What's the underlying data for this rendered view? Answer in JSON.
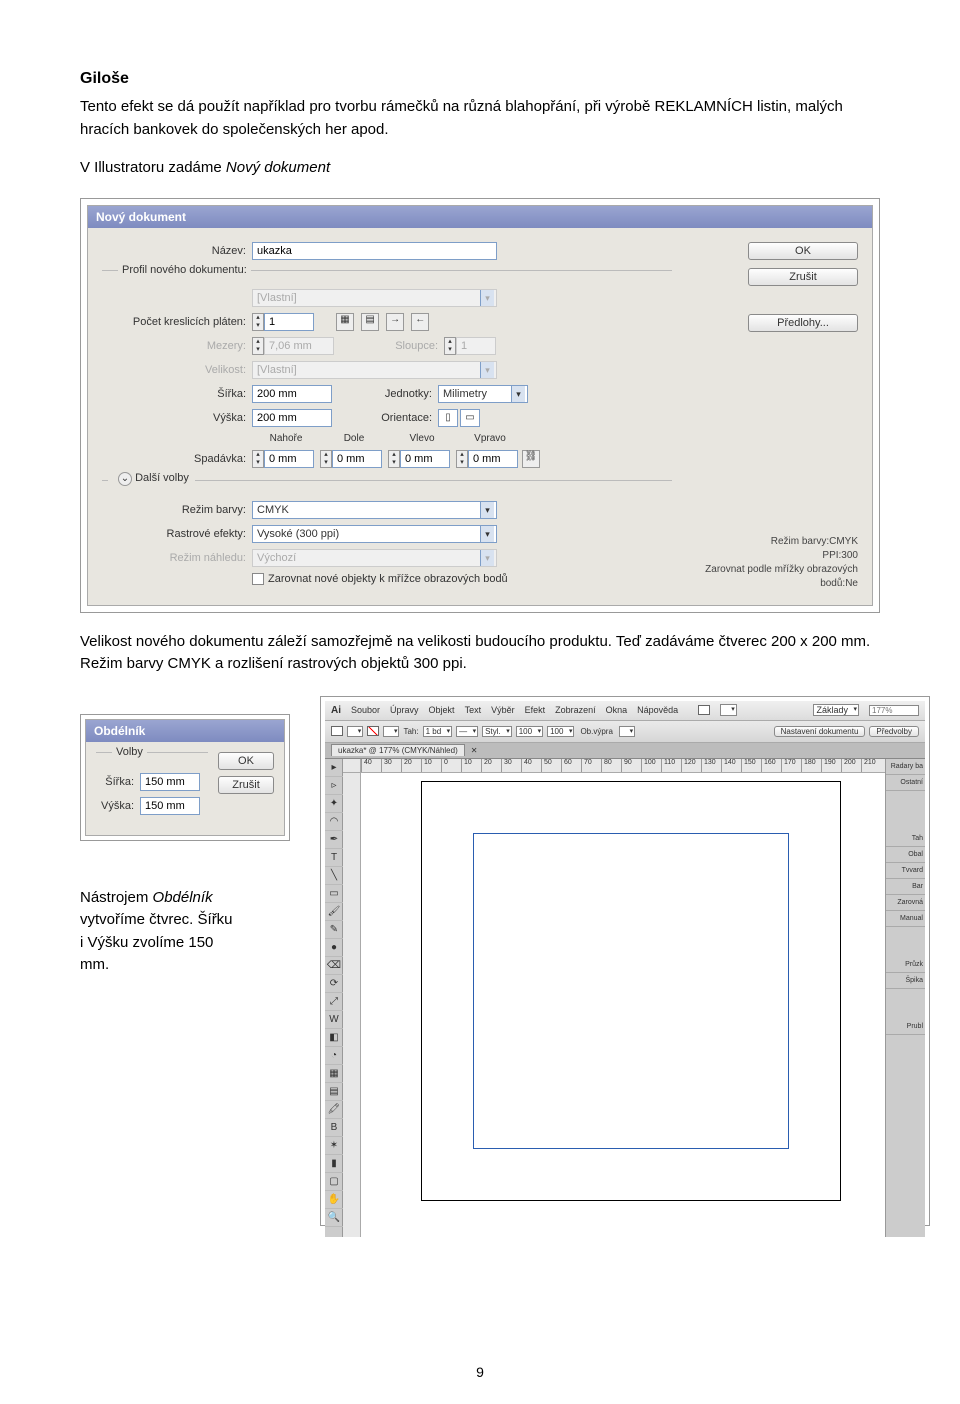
{
  "doc": {
    "heading": "Giloše",
    "p1": "Tento efekt se dá použít například pro tvorbu rámečků na různá blahopřání, při výrobě REKLAMNÍCH listin, malých hracích bankovek do společenských her apod.",
    "p2_a": "V Illustratoru zadáme ",
    "p2_b": "Nový dokument",
    "p3": "Velikost nového dokumentu záleží samozřejmě na velikosti budoucího produktu. Teď zadáváme čtverec 200 x 200 mm. Režim barvy CMYK a rozlišení rastrových objektů 300 ppi.",
    "p4_a": "Nástrojem ",
    "p4_b": "Obdélník",
    "p4_c": " vytvoříme čtvrec. Šířku i Výšku zvolíme 150 mm.",
    "page_number": "9"
  },
  "newdoc": {
    "title": "Nový dokument",
    "name_lbl": "Název:",
    "name_val": "ukazka",
    "profile_lbl": "Profil nového dokumentu:",
    "profile_val": "[Vlastní]",
    "artboards_lbl": "Počet kreslicích pláten:",
    "artboards_val": "1",
    "spacing_lbl": "Mezery:",
    "spacing_val": "7,06 mm",
    "cols_lbl": "Sloupce:",
    "cols_val": "1",
    "size_lbl": "Velikost:",
    "size_val": "[Vlastní]",
    "width_lbl": "Šířka:",
    "width_val": "200 mm",
    "units_lbl": "Jednotky:",
    "units_val": "Milimetry",
    "height_lbl": "Výška:",
    "height_val": "200 mm",
    "orient_lbl": "Orientace:",
    "bleed_lbl": "Spadávka:",
    "top": "Nahoře",
    "bottom": "Dole",
    "left": "Vlevo",
    "right": "Vpravo",
    "bleed_val": "0 mm",
    "adv": "Další volby",
    "cmode_lbl": "Režim barvy:",
    "cmode_val": "CMYK",
    "raster_lbl": "Rastrové efekty:",
    "raster_val": "Vysoké (300 ppi)",
    "preview_lbl": "Režim náhledu:",
    "preview_val": "Výchozí",
    "align_chk": "Zarovnat nové objekty k mřížce obrazových bodů",
    "ok": "OK",
    "cancel": "Zrušit",
    "templates": "Předlohy...",
    "info1": "Režim barvy:CMYK",
    "info2": "PPI:300",
    "info3": "Zarovnat podle mřížky obrazových bodů:Ne"
  },
  "rect": {
    "title": "Obdélník",
    "group": "Volby",
    "width_lbl": "Šířka:",
    "width_val": "150 mm",
    "height_lbl": "Výška:",
    "height_val": "150 mm",
    "ok": "OK",
    "cancel": "Zrušit"
  },
  "app": {
    "menu": [
      "Soubor",
      "Úpravy",
      "Objekt",
      "Text",
      "Výběr",
      "Efekt",
      "Zobrazení",
      "Okna",
      "Nápověda"
    ],
    "zoom": "177%",
    "ws_label": "Základy",
    "doc_settings": "Nastavení dokumentu",
    "prefs": "Předvolby",
    "stroke_lbl": "Tah:",
    "stroke_val": "1 bd",
    "style_val": "Styl.",
    "opacity_val": "100",
    "transform_lbl": "Ob.výpra",
    "tab_name": "ukazka* @ 177% (CMYK/Náhled)",
    "ruler_ticks": [
      "40",
      "30",
      "20",
      "10",
      "0",
      "10",
      "20",
      "30",
      "40",
      "50",
      "60",
      "70",
      "80",
      "90",
      "100",
      "110",
      "120",
      "130",
      "140",
      "150",
      "160",
      "170",
      "180",
      "190",
      "200",
      "210"
    ],
    "panels": [
      "Radary ba",
      "Ostatní",
      "Tah",
      "Obal",
      "Tvvard",
      "Bar",
      "Zarovná",
      "Manual",
      "Průzk",
      "Špika",
      "Prubl"
    ]
  }
}
